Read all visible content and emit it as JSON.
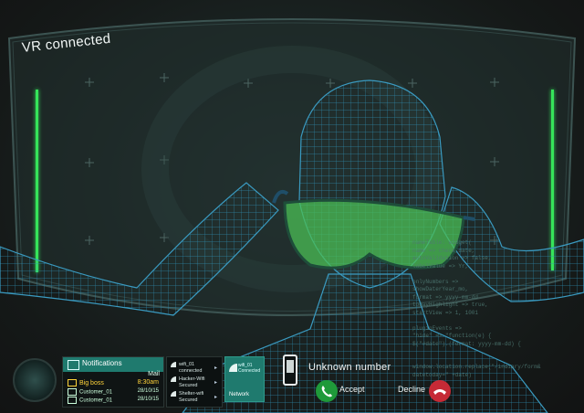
{
  "vr_status": "VR connected",
  "code_lines": [
    "nameTable: widget(",
    "name => check_date,",
    "autoValidation => false,",
    "labelValue => Yr,",
    "",
    "onlyNumbers => ",
    "showDaterYear_mo,",
    "format => yyyy-mm-dd",
    "todayHighlight => true,",
    "startView => 1, 1001",
    "",
    "pluginEvents =>",
    "\"hide\" => \"function(e) {",
    "$(\"#date\").(format: yyyy-mm-dd) {",
    "",
    "",
    "window.location.replace(\"/indiary/form&",
    "datetoday=\" +date)"
  ],
  "notifications": {
    "title": "Notifications",
    "mail_label": "Mail",
    "items": [
      {
        "name": "Big boss",
        "value": "8:30am"
      },
      {
        "name": "Customer_01",
        "value": "28/10/15"
      },
      {
        "name": "Customer_01",
        "value": "28/10/15"
      }
    ]
  },
  "wifi": {
    "items": [
      {
        "name": "wifi_01",
        "status": "connected"
      },
      {
        "name": "Hacker-Wifi",
        "status": "Secured"
      },
      {
        "name": "Shelter-wifi",
        "status": "Secured"
      }
    ]
  },
  "network": {
    "name": "wifi_01",
    "status": "Connected",
    "label": "Network"
  },
  "call": {
    "caller": "Unknown  number",
    "accept": "Accept",
    "decline": "Decline"
  },
  "colors": {
    "accent": "#1f7a6e",
    "green": "#1f9a3a",
    "red": "#c62a36",
    "wireframe": "#2f7fa3",
    "goggles": "#4bbf55"
  }
}
